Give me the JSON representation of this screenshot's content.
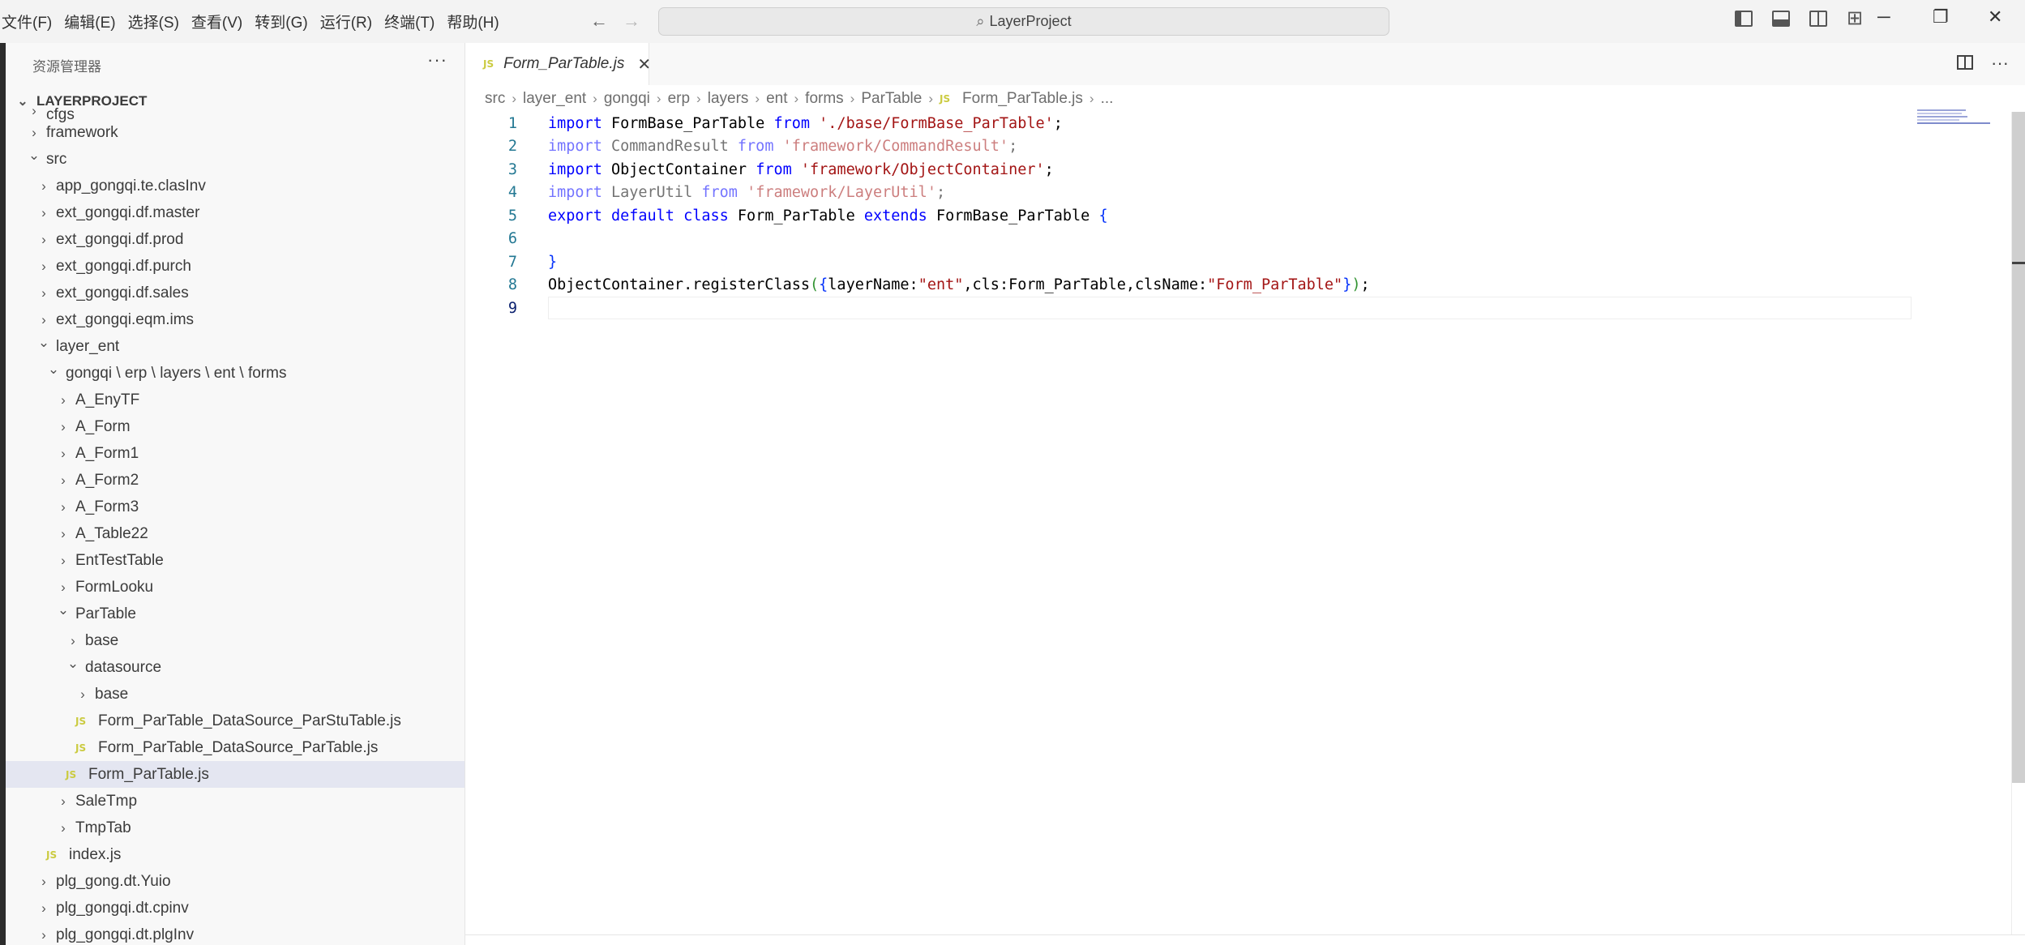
{
  "menu": [
    "文件(F)",
    "编辑(E)",
    "选择(S)",
    "查看(V)",
    "转到(G)",
    "运行(R)",
    "终端(T)",
    "帮助(H)"
  ],
  "search": {
    "label": "LayerProject",
    "icon": "search-icon"
  },
  "window_controls": {
    "minimize": "─",
    "restore": "❐",
    "close": "✕"
  },
  "nav": {
    "back": "←",
    "forward": "→"
  },
  "sidebar": {
    "title": "资源管理器",
    "more": "···",
    "project": "LAYERPROJECT",
    "items": [
      {
        "label": "cfgs",
        "type": "folder",
        "open": false,
        "depth": 1
      },
      {
        "label": "framework",
        "type": "folder",
        "open": false,
        "depth": 1
      },
      {
        "label": "src",
        "type": "folder",
        "open": true,
        "depth": 1
      },
      {
        "label": "app_gongqi.te.clasInv",
        "type": "folder",
        "open": false,
        "depth": 2
      },
      {
        "label": "ext_gongqi.df.master",
        "type": "folder",
        "open": false,
        "depth": 2
      },
      {
        "label": "ext_gongqi.df.prod",
        "type": "folder",
        "open": false,
        "depth": 2
      },
      {
        "label": "ext_gongqi.df.purch",
        "type": "folder",
        "open": false,
        "depth": 2
      },
      {
        "label": "ext_gongqi.df.sales",
        "type": "folder",
        "open": false,
        "depth": 2
      },
      {
        "label": "ext_gongqi.eqm.ims",
        "type": "folder",
        "open": false,
        "depth": 2
      },
      {
        "label": "layer_ent",
        "type": "folder",
        "open": true,
        "depth": 2
      },
      {
        "label": "gongqi \\ erp \\ layers \\ ent \\ forms",
        "type": "folder",
        "open": true,
        "depth": 3
      },
      {
        "label": "A_EnyTF",
        "type": "folder",
        "open": false,
        "depth": 4
      },
      {
        "label": "A_Form",
        "type": "folder",
        "open": false,
        "depth": 4
      },
      {
        "label": "A_Form1",
        "type": "folder",
        "open": false,
        "depth": 4
      },
      {
        "label": "A_Form2",
        "type": "folder",
        "open": false,
        "depth": 4
      },
      {
        "label": "A_Form3",
        "type": "folder",
        "open": false,
        "depth": 4
      },
      {
        "label": "A_Table22",
        "type": "folder",
        "open": false,
        "depth": 4
      },
      {
        "label": "EntTestTable",
        "type": "folder",
        "open": false,
        "depth": 4
      },
      {
        "label": "FormLooku",
        "type": "folder",
        "open": false,
        "depth": 4
      },
      {
        "label": "ParTable",
        "type": "folder",
        "open": true,
        "depth": 4
      },
      {
        "label": "base",
        "type": "folder",
        "open": false,
        "depth": 5
      },
      {
        "label": "datasource",
        "type": "folder",
        "open": true,
        "depth": 5
      },
      {
        "label": "base",
        "type": "folder",
        "open": false,
        "depth": 6
      },
      {
        "label": "Form_ParTable_DataSource_ParStuTable.js",
        "type": "js",
        "depth": 6
      },
      {
        "label": "Form_ParTable_DataSource_ParTable.js",
        "type": "js",
        "depth": 6
      },
      {
        "label": "Form_ParTable.js",
        "type": "js",
        "depth": 5,
        "selected": true
      },
      {
        "label": "SaleTmp",
        "type": "folder",
        "open": false,
        "depth": 4
      },
      {
        "label": "TmpTab",
        "type": "folder",
        "open": false,
        "depth": 4
      },
      {
        "label": "index.js",
        "type": "js",
        "depth": 3
      },
      {
        "label": "plg_gong.dt.Yuio",
        "type": "folder",
        "open": false,
        "depth": 2
      },
      {
        "label": "plg_gongqi.dt.cpinv",
        "type": "folder",
        "open": false,
        "depth": 2
      },
      {
        "label": "plg_gongqi.dt.plgInv",
        "type": "folder",
        "open": false,
        "depth": 2
      }
    ]
  },
  "tab": {
    "badge": "JS",
    "label": "Form_ParTable.js",
    "close": "✕"
  },
  "editor_actions": {
    "more": "···"
  },
  "breadcrumb": [
    "src",
    "layer_ent",
    "gongqi",
    "erp",
    "layers",
    "ent",
    "forms",
    "ParTable"
  ],
  "breadcrumb_file": "Form_ParTable.js",
  "breadcrumb_more": "...",
  "code": {
    "line_numbers": [
      "1",
      "2",
      "3",
      "4",
      "5",
      "6",
      "7",
      "8",
      "9"
    ],
    "l1": {
      "kw1": "import",
      "name": " FormBase_ParTable ",
      "kw2": "from",
      "sp": " ",
      "str": "'./base/FormBase_ParTable'",
      "end": ";"
    },
    "l2": {
      "kw1": "import",
      "name": " CommandResult ",
      "kw2": "from",
      "sp": " ",
      "str": "'framework/CommandResult'",
      "end": ";"
    },
    "l3": {
      "kw1": "import",
      "name": " ObjectContainer ",
      "kw2": "from",
      "sp": " ",
      "str": "'framework/ObjectContainer'",
      "end": ";"
    },
    "l4": {
      "kw1": "import",
      "name": " LayerUtil ",
      "kw2": "from",
      "sp": " ",
      "str": "'framework/LayerUtil'",
      "end": ";"
    },
    "l5": {
      "kw1": "export",
      "kw2": "default",
      "kw3": "class",
      "name": "Form_ParTable",
      "kw4": "extends",
      "base": "FormBase_ParTable",
      "brace": "{"
    },
    "l7": {
      "brace": "}"
    },
    "l8": {
      "obj": "ObjectContainer.registerClass",
      "open": "(",
      "brace_open": "{",
      "k1": "layerName:",
      "v1": "\"ent\"",
      "k2": ",cls:Form_ParTable,clsName:",
      "v2": "\"Form_ParTable\"",
      "brace_close": "}",
      "close": ")",
      "end": ";"
    }
  }
}
